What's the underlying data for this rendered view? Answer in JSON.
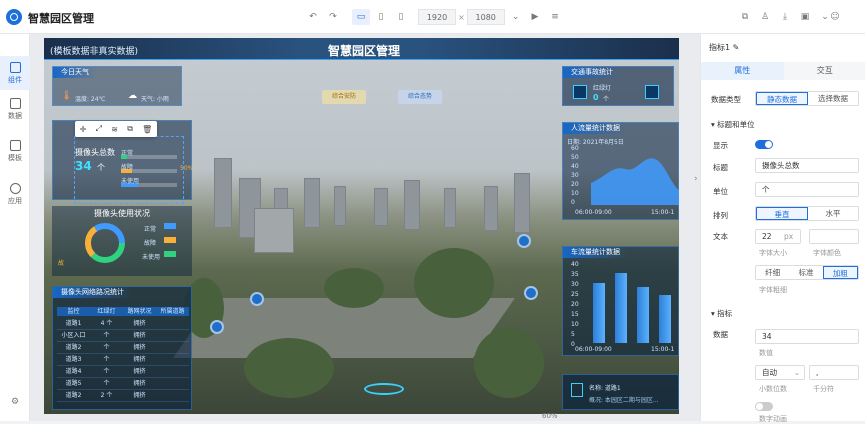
{
  "app": {
    "title": "智慧园区管理"
  },
  "toolbar": {
    "width": "1920",
    "times": "×",
    "height": "1080"
  },
  "sidebar": {
    "items": [
      {
        "label": "组件",
        "icon": "grid-icon"
      },
      {
        "label": "数据",
        "icon": "database-icon"
      },
      {
        "label": "模板",
        "icon": "template-icon"
      },
      {
        "label": "应用",
        "icon": "app-icon"
      }
    ]
  },
  "board": {
    "title": "智慧园区管理",
    "note": "(模板数据非真实数据)",
    "weather": {
      "header": "今日天气",
      "temp": "温度: 24℃",
      "weather": "天气: 小雨"
    },
    "camera": {
      "header": "摄像头总数",
      "count": "34",
      "unit": "个",
      "legend": [
        "正常",
        "故障",
        "未使用"
      ],
      "pct": "50%"
    },
    "usage": {
      "header": "摄像头使用状况",
      "labels": [
        "正常",
        "故障",
        "未使用"
      ],
      "side": "故"
    },
    "traffic": {
      "header": "交通事故统计",
      "light_label": "红绿灯",
      "light_value": "0",
      "light_unit": "个"
    },
    "people": {
      "header": "人流量统计数据",
      "date": "日期: 2021年8月5日",
      "yticks": [
        "60",
        "50",
        "40",
        "30",
        "20",
        "10",
        "0"
      ],
      "xticks": [
        "06:00-09:00",
        "15:00-1"
      ]
    },
    "vehicle": {
      "header": "车流量统计数据",
      "yticks": [
        "40",
        "35",
        "30",
        "25",
        "20",
        "15",
        "10",
        "5",
        "0"
      ],
      "xticks": [
        "06:00-09:00",
        "15:00-1"
      ]
    },
    "table": {
      "header": "摄像头网络路况统计",
      "cols": [
        "监控",
        "红绿灯",
        "路网状况",
        "所属道路"
      ],
      "rows": [
        [
          "道路1",
          "4 个",
          "拥挤",
          ""
        ],
        [
          "小区入口",
          "个",
          "拥挤",
          ""
        ],
        [
          "道路2",
          "个",
          "拥挤",
          ""
        ],
        [
          "道路3",
          "个",
          "拥挤",
          ""
        ],
        [
          "道路4",
          "个",
          "拥挤",
          ""
        ],
        [
          "道路5",
          "个",
          "拥挤",
          ""
        ],
        [
          "道路2",
          "2 个",
          "拥挤",
          ""
        ]
      ]
    },
    "tabs": [
      "综合安防",
      "综合态势"
    ],
    "info": {
      "name": "名称: 道路1",
      "desc": "概况: 本园区二期与园区..."
    },
    "zoom": "60%"
  },
  "panel": {
    "header": "指标1",
    "tabs": [
      "属性",
      "交互"
    ],
    "data_type_label": "数据类型",
    "data_type_options": [
      "静态数据",
      "选择数据"
    ],
    "section_title_unit": "标题和单位",
    "show_label": "显示",
    "title_label": "标题",
    "title_value": "摄像头总数",
    "unit_label": "单位",
    "unit_value": "个",
    "arrange_label": "排列",
    "arrange_options": [
      "垂直",
      "水平"
    ],
    "text_label": "文本",
    "font_size_value": "22",
    "font_size_unit": "px",
    "font_size_caption": "字体大小",
    "font_color_caption": "字体颜色",
    "weight_options": [
      "纤细",
      "标准",
      "加粗"
    ],
    "weight_caption": "字体粗细",
    "section_metric": "指标",
    "data_label": "数据",
    "data_value": "34",
    "data_caption": "数值",
    "decimal_value": "自动",
    "decimal_caption": "小数位数",
    "thousand_value": ",",
    "thousand_caption": "千分符",
    "anim_caption": "数字动画"
  }
}
